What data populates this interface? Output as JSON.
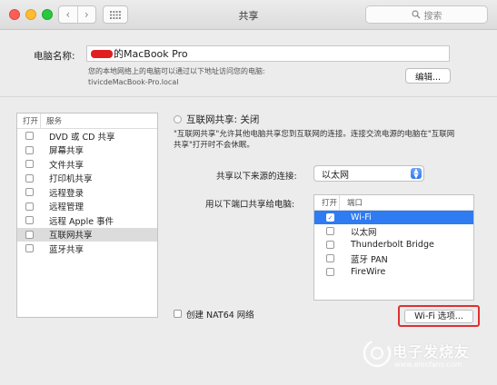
{
  "window": {
    "title": "共享"
  },
  "search": {
    "placeholder": "搜索"
  },
  "computer_name": {
    "label": "电脑名称:",
    "value": "的MacBook Pro",
    "hint_line1": "您的本地网络上的电脑可以通过以下地址访问您的电脑:",
    "hint_line2": "tivicdeMacBook-Pro.local",
    "edit_label": "编辑..."
  },
  "services": {
    "col_on": "打开",
    "col_service": "服务",
    "items": [
      {
        "label": "DVD 或 CD 共享",
        "checked": false
      },
      {
        "label": "屏幕共享",
        "checked": false
      },
      {
        "label": "文件共享",
        "checked": false
      },
      {
        "label": "打印机共享",
        "checked": false
      },
      {
        "label": "远程登录",
        "checked": false
      },
      {
        "label": "远程管理",
        "checked": false
      },
      {
        "label": "远程 Apple 事件",
        "checked": false
      },
      {
        "label": "互联网共享",
        "checked": false,
        "selected": true
      },
      {
        "label": "蓝牙共享",
        "checked": false
      }
    ]
  },
  "internet_sharing": {
    "status": "互联网共享: 关闭",
    "desc_line1": "\"互联网共享\"允许其他电脑共享您到互联网的连接。连接交流电源的电脑在\"互联网",
    "desc_line2": "共享\"打开时不会休眠。",
    "from_label": "共享以下来源的连接:",
    "from_value": "以太网",
    "to_label": "用以下端口共享给电脑:",
    "ports_col_on": "打开",
    "ports_col_port": "端口",
    "ports": [
      {
        "label": "Wi-Fi",
        "checked": true,
        "selected": true
      },
      {
        "label": "以太网",
        "checked": false
      },
      {
        "label": "Thunderbolt Bridge",
        "checked": false
      },
      {
        "label": "蓝牙 PAN",
        "checked": false
      },
      {
        "label": "FireWire",
        "checked": false
      }
    ],
    "nat64_label": "创建 NAT64 网络",
    "wifi_options_label": "Wi-Fi 选项..."
  },
  "watermark": {
    "text": "电子发烧友",
    "url": "www.elecfans.com"
  },
  "colors": {
    "accent": "#2f7bf2",
    "highlight_border": "#e03030"
  }
}
